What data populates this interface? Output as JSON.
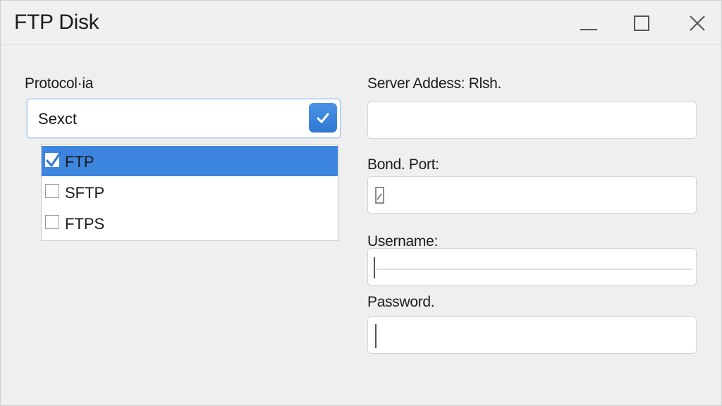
{
  "window": {
    "title": "FTP Disk",
    "controls": [
      "minimize",
      "maximize",
      "close"
    ]
  },
  "protocol": {
    "label": "Protocol·ia",
    "selected_value": "Sexct",
    "options": [
      {
        "label": "FTP",
        "checked": true
      },
      {
        "label": "SFTP",
        "checked": false
      },
      {
        "label": "FTPS",
        "checked": false
      }
    ]
  },
  "server": {
    "label": "Server Addess: Rlsh.",
    "value": ""
  },
  "port": {
    "label": "Bond. Port:",
    "value": ""
  },
  "username": {
    "label": "Username:",
    "value": ""
  },
  "password": {
    "label": "Password.",
    "value": ""
  },
  "colors": {
    "accent": "#3d86e0",
    "window_bg": "#efefef"
  }
}
